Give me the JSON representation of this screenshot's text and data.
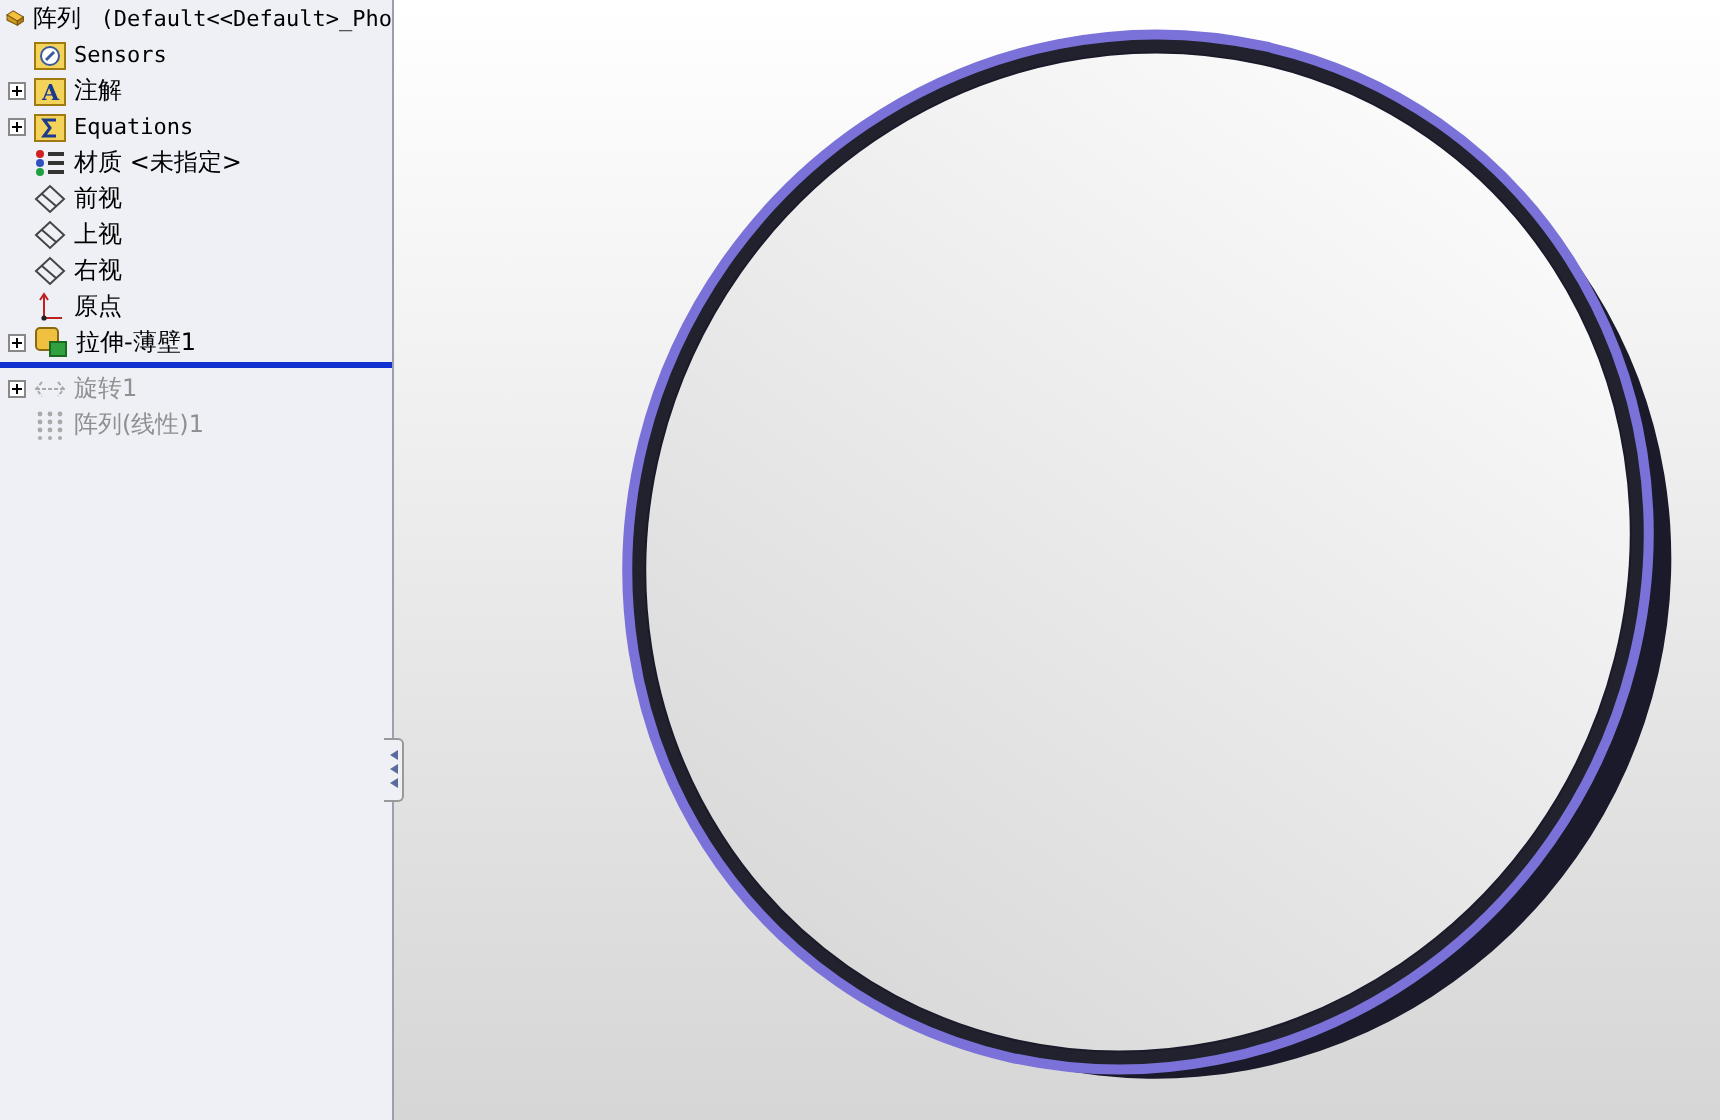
{
  "tree": {
    "root": {
      "label": "阵列",
      "config": "(Default<<Default>_Pho"
    },
    "items": [
      {
        "kind": "sensors",
        "label": "Sensors",
        "expandable": false,
        "suppressed": false
      },
      {
        "kind": "annotations",
        "icon_text": "A",
        "label": "注解",
        "expandable": true,
        "suppressed": false
      },
      {
        "kind": "equations",
        "label": "Equations",
        "expandable": true,
        "suppressed": false
      },
      {
        "kind": "material",
        "label": "材质 <未指定>",
        "expandable": false,
        "suppressed": false
      },
      {
        "kind": "plane",
        "label": "前视",
        "expandable": false,
        "suppressed": false
      },
      {
        "kind": "plane",
        "label": "上视",
        "expandable": false,
        "suppressed": false
      },
      {
        "kind": "plane",
        "label": "右视",
        "expandable": false,
        "suppressed": false
      },
      {
        "kind": "origin",
        "label": "原点",
        "expandable": false,
        "suppressed": false
      },
      {
        "kind": "extrude",
        "label": "拉伸-薄壁1",
        "expandable": true,
        "suppressed": false
      },
      {
        "kind": "rollback"
      },
      {
        "kind": "revolve",
        "label": "旋转1",
        "expandable": true,
        "suppressed": true
      },
      {
        "kind": "pattern",
        "label": "阵列(线性)1",
        "expandable": false,
        "suppressed": true
      }
    ]
  }
}
